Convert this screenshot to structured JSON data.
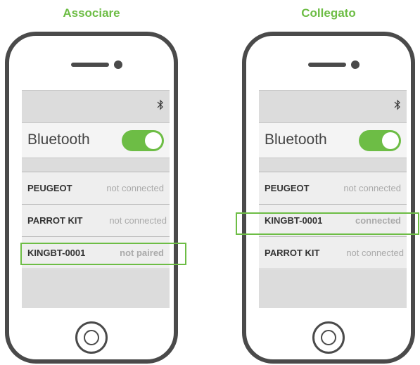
{
  "accent_color": "#6dbd45",
  "left": {
    "title": "Associare",
    "bluetooth_icon": "bluetooth-icon",
    "bluetooth_label": "Bluetooth",
    "toggle_on": true,
    "devices": [
      {
        "name": "PEUGEOT",
        "status": "not connected"
      },
      {
        "name": "PARROT KIT",
        "status": "not connected"
      },
      {
        "name": "KINGBT-0001",
        "status": "not paired"
      }
    ],
    "highlighted_device": "KINGBT-0001"
  },
  "right": {
    "title": "Collegato",
    "bluetooth_icon": "bluetooth-icon",
    "bluetooth_label": "Bluetooth",
    "toggle_on": true,
    "devices": [
      {
        "name": "PEUGEOT",
        "status": "not connected"
      },
      {
        "name": "KINGBT-0001",
        "status": "connected"
      },
      {
        "name": "PARROT KIT",
        "status": "not connected"
      }
    ],
    "highlighted_device": "KINGBT-0001"
  }
}
